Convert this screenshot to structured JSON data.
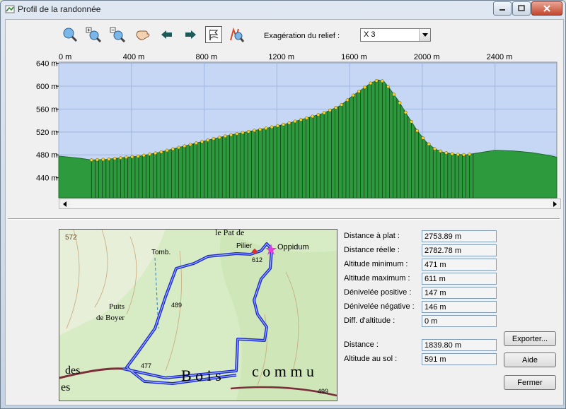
{
  "window": {
    "title": "Profil de la randonnée"
  },
  "toolbar": {
    "buttons": [
      {
        "name": "zoom-fit-icon"
      },
      {
        "name": "zoom-in-icon"
      },
      {
        "name": "zoom-out-icon"
      },
      {
        "name": "pan-hand-icon"
      },
      {
        "name": "arrow-left-icon"
      },
      {
        "name": "arrow-right-icon"
      },
      {
        "name": "route-flag-icon"
      },
      {
        "name": "route-zoom-icon"
      }
    ],
    "relief_label": "Exagération du relief :",
    "relief_value": "X 3"
  },
  "chart_data": {
    "type": "area",
    "x_ticks": [
      "0 m",
      "400 m",
      "800 m",
      "1200 m",
      "1600 m",
      "2000 m",
      "2400 m"
    ],
    "y_ticks": [
      "640 m",
      "600 m",
      "560 m",
      "520 m",
      "480 m",
      "440 m"
    ],
    "xlim": [
      0,
      2740
    ],
    "ylim": [
      405,
      642
    ],
    "x": [
      0,
      120,
      180,
      260,
      350,
      450,
      550,
      650,
      750,
      850,
      950,
      1050,
      1150,
      1250,
      1350,
      1450,
      1550,
      1620,
      1680,
      1720,
      1760,
      1790,
      1820,
      1870,
      1920,
      1970,
      2020,
      2070,
      2120,
      2180,
      2240,
      2300,
      2400,
      2500,
      2600,
      2700,
      2740
    ],
    "elevation": [
      478,
      474,
      471,
      472,
      475,
      478,
      484,
      492,
      500,
      508,
      515,
      521,
      527,
      534,
      543,
      552,
      566,
      584,
      597,
      606,
      611,
      608,
      596,
      574,
      548,
      523,
      503,
      490,
      484,
      481,
      480,
      483,
      488,
      487,
      484,
      479,
      476
    ],
    "marked_range": [
      180,
      2290
    ],
    "color_fill": "#2e9a3e",
    "color_sky": "#c6d7f5"
  },
  "stats": [
    {
      "label": "Distance à plat :",
      "value": "2753.89 m"
    },
    {
      "label": "Distance réelle :",
      "value": "2782.78 m"
    },
    {
      "label": "Altitude minimum :",
      "value": "471 m"
    },
    {
      "label": "Altitude maximum :",
      "value": "611 m"
    },
    {
      "label": "Dénivelée positive :",
      "value": "147 m"
    },
    {
      "label": "Dénivelée négative :",
      "value": "146 m"
    },
    {
      "label": "Diff. d'altitude :",
      "value": "0 m"
    },
    {
      "label": "Distance :",
      "value": "1839.80 m"
    },
    {
      "label": "Altitude au sol :",
      "value": "591 m"
    }
  ],
  "buttons": {
    "export": "Exporter...",
    "help": "Aide",
    "close": "Fermer"
  },
  "map": {
    "labels": {
      "n572": "572",
      "tomb": "Tomb.",
      "pilier": "Pilier",
      "oppidum": "Oppidum",
      "n612": "612",
      "n489": "489",
      "puits": "Puits",
      "de_boyer": "de Boyer",
      "n477": "477",
      "bois": "B o i s",
      "commu": "c o m m u",
      "des": "des",
      "es": "es",
      "n499": "499",
      "pat": "le  Pat  de"
    }
  }
}
